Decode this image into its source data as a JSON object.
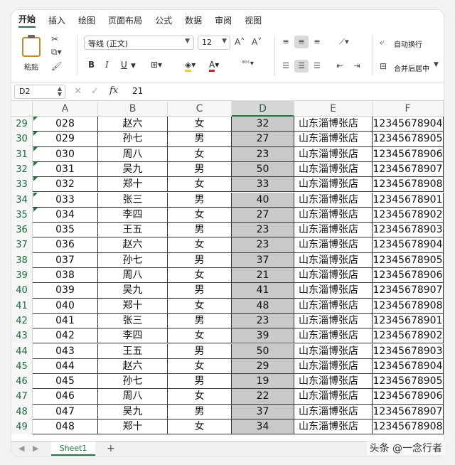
{
  "menu": [
    "开始",
    "插入",
    "绘图",
    "页面布局",
    "公式",
    "数据",
    "审阅",
    "视图"
  ],
  "ribbon": {
    "paste_label": "粘贴",
    "font_name": "等线 (正文)",
    "font_size": "12",
    "grow_font": "A˄",
    "shrink_font": "A˅",
    "bold": "B",
    "italic": "I",
    "underline": "U",
    "wrap_text": "自动换行",
    "merge_center": "合并后居中"
  },
  "formula_bar": {
    "name_box": "D2",
    "fx": "fx",
    "value": "21"
  },
  "columns": [
    "A",
    "B",
    "C",
    "D",
    "E",
    "F"
  ],
  "selected_column": "D",
  "rows": [
    {
      "n": "29",
      "a": "028",
      "b": "赵六",
      "c": "女",
      "d": "32",
      "e": "山东淄博张店",
      "f": "12345678904"
    },
    {
      "n": "30",
      "a": "029",
      "b": "孙七",
      "c": "男",
      "d": "27",
      "e": "山东淄博张店",
      "f": "12345678905"
    },
    {
      "n": "31",
      "a": "030",
      "b": "周八",
      "c": "女",
      "d": "23",
      "e": "山东淄博张店",
      "f": "12345678906"
    },
    {
      "n": "32",
      "a": "031",
      "b": "吴九",
      "c": "男",
      "d": "50",
      "e": "山东淄博张店",
      "f": "12345678907"
    },
    {
      "n": "33",
      "a": "032",
      "b": "郑十",
      "c": "女",
      "d": "33",
      "e": "山东淄博张店",
      "f": "12345678908"
    },
    {
      "n": "34",
      "a": "033",
      "b": "张三",
      "c": "男",
      "d": "40",
      "e": "山东淄博张店",
      "f": "12345678901"
    },
    {
      "n": "35",
      "a": "034",
      "b": "李四",
      "c": "女",
      "d": "27",
      "e": "山东淄博张店",
      "f": "12345678902"
    },
    {
      "n": "36",
      "a": "035",
      "b": "王五",
      "c": "男",
      "d": "23",
      "e": "山东淄博张店",
      "f": "12345678903"
    },
    {
      "n": "37",
      "a": "036",
      "b": "赵六",
      "c": "女",
      "d": "23",
      "e": "山东淄博张店",
      "f": "12345678904"
    },
    {
      "n": "38",
      "a": "037",
      "b": "孙七",
      "c": "男",
      "d": "37",
      "e": "山东淄博张店",
      "f": "12345678905"
    },
    {
      "n": "39",
      "a": "038",
      "b": "周八",
      "c": "女",
      "d": "21",
      "e": "山东淄博张店",
      "f": "12345678906"
    },
    {
      "n": "40",
      "a": "039",
      "b": "吴九",
      "c": "男",
      "d": "41",
      "e": "山东淄博张店",
      "f": "12345678907"
    },
    {
      "n": "41",
      "a": "040",
      "b": "郑十",
      "c": "女",
      "d": "48",
      "e": "山东淄博张店",
      "f": "12345678908"
    },
    {
      "n": "42",
      "a": "041",
      "b": "张三",
      "c": "男",
      "d": "23",
      "e": "山东淄博张店",
      "f": "12345678901"
    },
    {
      "n": "43",
      "a": "042",
      "b": "李四",
      "c": "女",
      "d": "39",
      "e": "山东淄博张店",
      "f": "12345678902"
    },
    {
      "n": "44",
      "a": "043",
      "b": "王五",
      "c": "男",
      "d": "50",
      "e": "山东淄博张店",
      "f": "12345678903"
    },
    {
      "n": "45",
      "a": "044",
      "b": "赵六",
      "c": "女",
      "d": "29",
      "e": "山东淄博张店",
      "f": "12345678904"
    },
    {
      "n": "46",
      "a": "045",
      "b": "孙七",
      "c": "男",
      "d": "19",
      "e": "山东淄博张店",
      "f": "12345678905"
    },
    {
      "n": "47",
      "a": "046",
      "b": "周八",
      "c": "女",
      "d": "22",
      "e": "山东淄博张店",
      "f": "12345678906"
    },
    {
      "n": "48",
      "a": "047",
      "b": "吴九",
      "c": "男",
      "d": "37",
      "e": "山东淄博张店",
      "f": "12345678907"
    },
    {
      "n": "49",
      "a": "048",
      "b": "郑十",
      "c": "女",
      "d": "34",
      "e": "山东淄博张店",
      "f": "12345678908"
    }
  ],
  "sheet_tab": "Sheet1",
  "add_sheet": "+",
  "watermark": "头条 @一念行者",
  "colors": {
    "accent": "#1d7a3f",
    "selection": "#c9c9c9"
  }
}
